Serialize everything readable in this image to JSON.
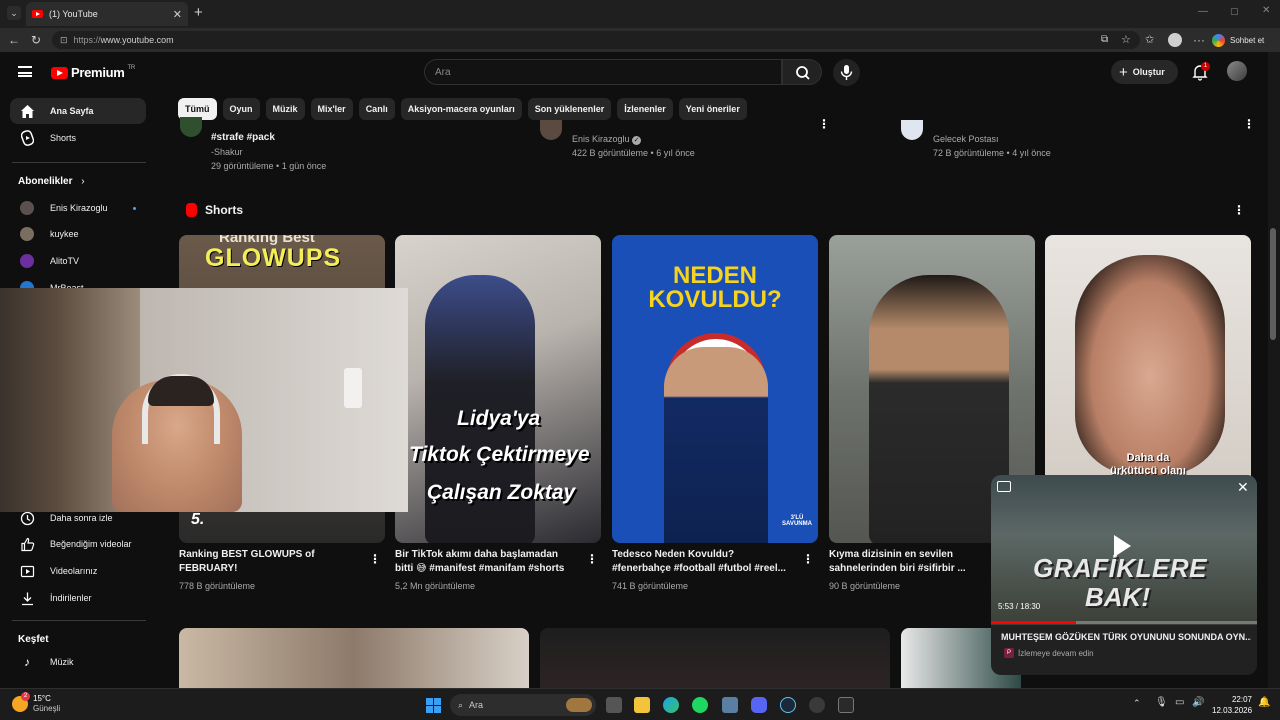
{
  "browser": {
    "tab_title": "(1) YouTube",
    "url_scheme": "https://",
    "url_host": "www.youtube.com",
    "copilot_label": "Sohbet et"
  },
  "header": {
    "logo_text": "Premium",
    "logo_badge": "TR",
    "search_placeholder": "Ara",
    "create_label": "Oluştur",
    "notification_count": "1"
  },
  "chips": [
    "Tümü",
    "Oyun",
    "Müzik",
    "Mix'ler",
    "Canlı",
    "Aksiyon-macera oyunları",
    "Son yüklenenler",
    "İzlenenler",
    "Yeni öneriler"
  ],
  "sidebar": {
    "home": "Ana Sayfa",
    "shorts": "Shorts",
    "subscriptions_heading": "Abonelikler",
    "subscriptions": [
      "Enis Kirazoglu",
      "kuykee",
      "AlitoTV",
      "MrBeast"
    ],
    "watch_later": "Daha sonra izle",
    "liked": "Beğendiğim videolar",
    "your_videos": "Videolarınız",
    "downloads": "İndirilenler",
    "explore_heading": "Keşfet",
    "music": "Müzik"
  },
  "top_videos": [
    {
      "title": "#strafe #pack",
      "channel": "-Shakur",
      "stats": "29 görüntüleme • 1 gün önce"
    },
    {
      "channel": "Enis Kirazoglu",
      "stats": "422 B görüntüleme • 6 yıl önce"
    },
    {
      "channel": "Gelecek Postası",
      "stats": "72 B görüntüleme • 4 yıl önce"
    }
  ],
  "shorts_heading": "Shorts",
  "shorts": [
    {
      "thumb_text_top": "Ranking Best",
      "thumb_text": "GLOWUPS",
      "thumb_num": "5.",
      "title1": "Ranking BEST GLOWUPS of",
      "title2": "FEBRUARY!",
      "views": "778 B görüntüleme"
    },
    {
      "thumb_text": "Lidya'ya",
      "thumb_text2": "Tiktok Çektirmeye",
      "thumb_text3": "Çalışan Zoktay",
      "title1": "Bir TikTok akımı daha başlamadan",
      "title2": "bitti 😅 #manifest #manifam #shorts",
      "views": "5,2 Mn görüntüleme"
    },
    {
      "thumb_text": "NEDEN",
      "thumb_text2": "KOVULDU?",
      "thumb_badge": "3'LÜ SAVUNMA",
      "title1": "Tedesco Neden Kovuldu?",
      "title2": "#fenerbahçe #football #futbol #reel...",
      "views": "741 B görüntüleme"
    },
    {
      "title1": "Kıyma dizisinin en sevilen",
      "title2": "sahnelerinden biri  #sifirbir ...",
      "views": "90 B görüntüleme"
    },
    {
      "thumb_text": "Daha da",
      "thumb_text2": "ürkütücü olanı"
    }
  ],
  "miniplayer": {
    "thumb_text1": "GRAFİKLERE",
    "thumb_text2": "BAK!",
    "time": "5:53 / 18:30",
    "progress": 0.32,
    "title": "MUHTEŞEM GÖZÜKEN TÜRK OYUNUNU SONUNDA OYN...",
    "continue_label": "İzlemeye devam edin"
  },
  "taskbar": {
    "weather_temp": "15°C",
    "weather_desc": "Güneşli",
    "weather_badge": "2",
    "search_label": "Ara",
    "time": "22:07",
    "date": "12.03.2026"
  },
  "colors": {
    "bg": "#0f0f0f",
    "brand_red": "#ff0000",
    "chip_bg": "#272727"
  }
}
